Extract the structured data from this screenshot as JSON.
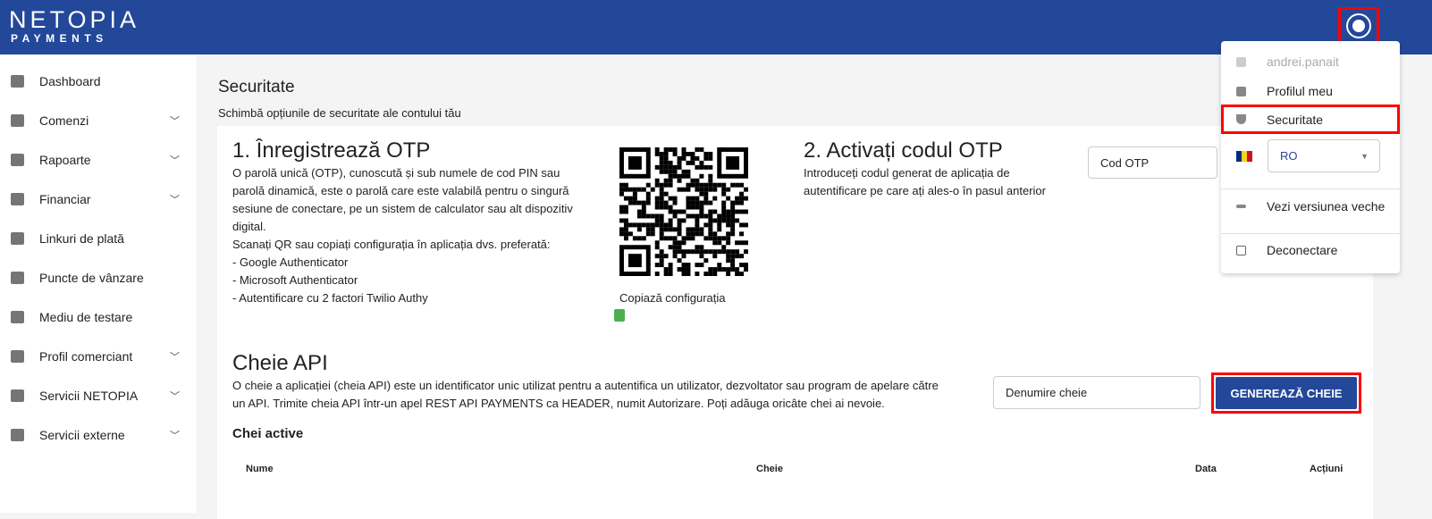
{
  "header": {
    "logo_top": "NETOPIA",
    "logo_bottom": "PAYMENTS"
  },
  "sidebar": {
    "items": [
      {
        "label": "Dashboard",
        "expandable": false
      },
      {
        "label": "Comenzi",
        "expandable": true
      },
      {
        "label": "Rapoarte",
        "expandable": true
      },
      {
        "label": "Financiar",
        "expandable": true
      },
      {
        "label": "Linkuri de plată",
        "expandable": false
      },
      {
        "label": "Puncte de vânzare",
        "expandable": false
      },
      {
        "label": "Mediu de testare",
        "expandable": false
      },
      {
        "label": "Profil comerciant",
        "expandable": true
      },
      {
        "label": "Servicii NETOPIA",
        "expandable": true
      },
      {
        "label": "Servicii externe",
        "expandable": true
      }
    ]
  },
  "page": {
    "title": "Securitate",
    "subtitle": "Schimbă opțiunile de securitate ale contului tău"
  },
  "otp": {
    "title": "1. Înregistrează OTP",
    "lines": [
      "O parolă unică (OTP), cunoscută și sub numele de cod PIN sau",
      "parolă dinamică, este o parolă care este valabilă pentru o singură",
      "sesiune de conectare, pe un sistem de calculator sau alt dispozitiv",
      "digital.",
      "Scanați QR sau copiați configurația în aplicația dvs. preferată:",
      "- Google Authenticator",
      "- Microsoft Authenticator",
      "- Autentificare cu 2 factori Twilio Authy"
    ],
    "copy_label": "Copiază configurația"
  },
  "activate": {
    "title": "2. Activați codul OTP",
    "lines": [
      "Introduceți codul generat de aplicația de",
      "autentificare pe care ați ales-o în pasul anterior"
    ],
    "input_placeholder": "Cod OTP"
  },
  "api": {
    "title": "Cheie API",
    "lines": [
      "O cheie a aplicației (cheia API) este un identificator unic utilizat pentru a autentifica un utilizator, dezvoltator sau program de apelare către",
      "un API. Trimite cheia API într-un apel REST API PAYMENTS ca HEADER, numit Autorizare. Poți adăuga oricâte chei ai nevoie."
    ],
    "name_placeholder": "Denumire cheie",
    "generate_label": "GENEREAZĂ CHEIE",
    "active_title": "Chei active",
    "columns": [
      "Nume",
      "Cheie",
      "Data",
      "Acțiuni"
    ]
  },
  "menu": {
    "username": "andrei.panait",
    "profile": "Profilul meu",
    "security": "Securitate",
    "language": "RO",
    "old_version": "Vezi versiunea veche",
    "logout": "Deconectare"
  },
  "colors": {
    "brand": "#234899",
    "highlight": "#ff0000",
    "copy": "#4caf50"
  }
}
